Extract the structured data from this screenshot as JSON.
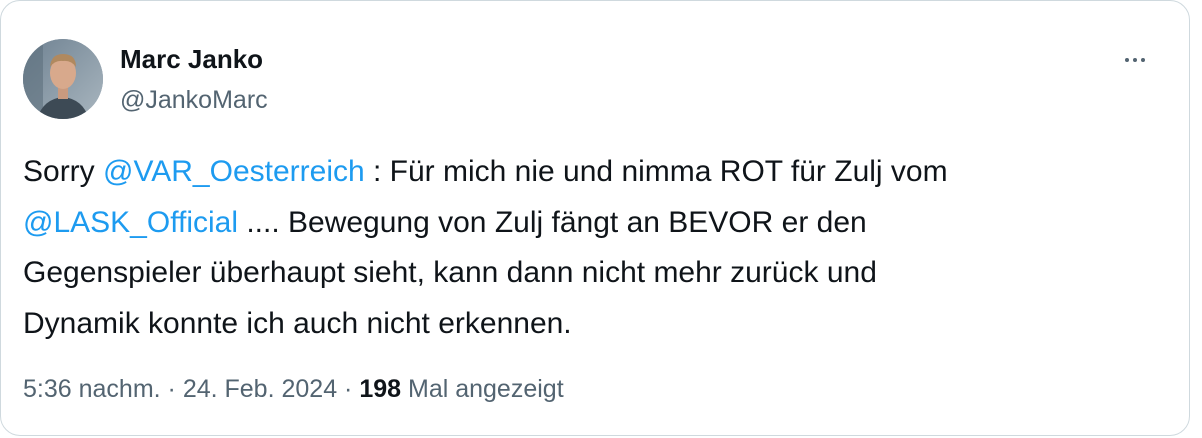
{
  "author": {
    "display_name": "Marc Janko",
    "handle": "@JankoMarc"
  },
  "tweet": {
    "line1_prefix": "Sorry ",
    "mention1": "@VAR_Oesterreich",
    "line1_suffix": " : Für mich nie und nimma ROT für Zulj vom",
    "mention2": "@LASK_Official",
    "line2_suffix": " .... Bewegung von Zulj fängt an BEVOR er den",
    "line3": "Gegenspieler überhaupt sieht, kann dann nicht mehr zurück und",
    "line4": "Dynamik konnte ich auch nicht erkennen."
  },
  "meta": {
    "time": "5:36 nachm.",
    "separator": " · ",
    "date": "24. Feb. 2024",
    "views_count": "198",
    "views_label": " Mal angezeigt"
  },
  "icons": {
    "more": "more-horizontal-icon"
  },
  "colors": {
    "text_primary": "#0f1419",
    "text_secondary": "#536471",
    "link": "#1d9bf0",
    "border": "#cfd9de"
  }
}
